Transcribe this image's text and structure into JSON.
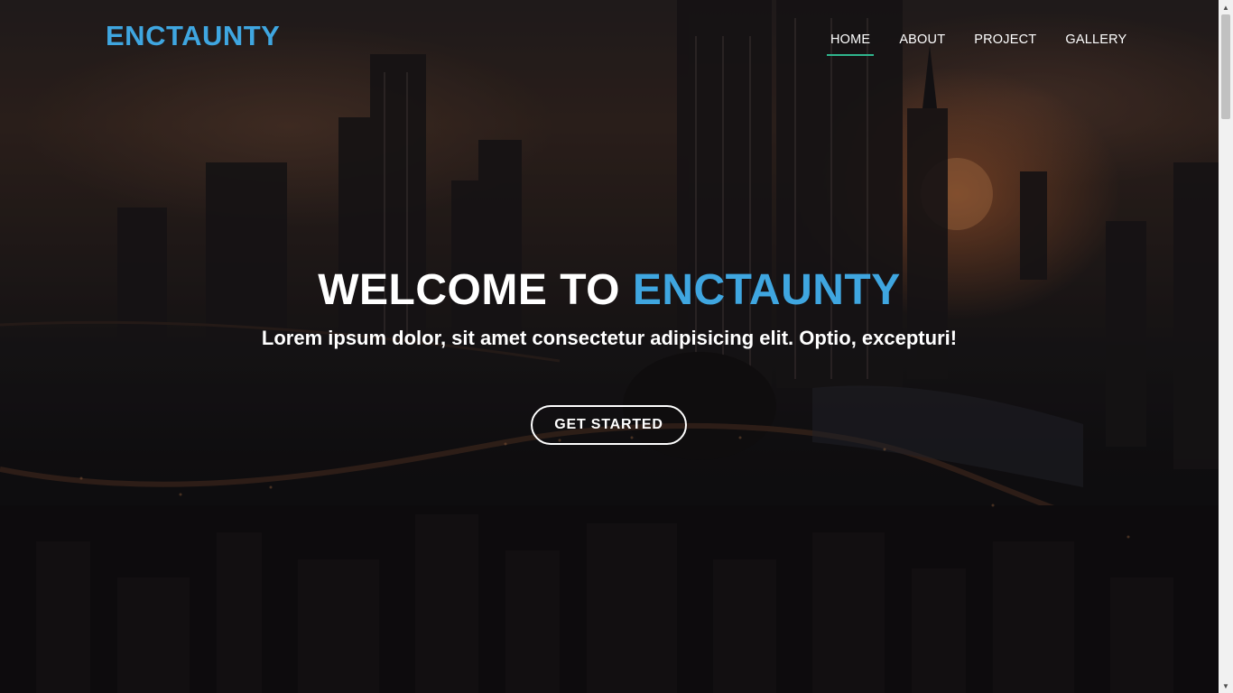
{
  "header": {
    "logo": "ENCTAUNTY",
    "nav": [
      {
        "label": "HOME",
        "active": true
      },
      {
        "label": "ABOUT",
        "active": false
      },
      {
        "label": "PROJECT",
        "active": false
      },
      {
        "label": "GALLERY",
        "active": false
      }
    ]
  },
  "hero": {
    "title_prefix": "WELCOME TO",
    "title_accent": "ENCTAUNTY",
    "subtitle": "Lorem ipsum dolor, sit amet consectetur adipisicing elit. Optio, excepturi!",
    "cta_label": "GET STARTED"
  },
  "colors": {
    "accent": "#3fa6e0",
    "nav_active_underline": "#2fb58d",
    "text": "#ffffff"
  },
  "icons": {
    "scroll_up": "triangle-up",
    "scroll_down": "triangle-down"
  }
}
